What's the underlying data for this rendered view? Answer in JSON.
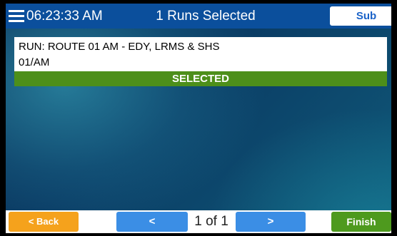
{
  "header": {
    "menu_icon": "hamburger-menu-icon",
    "time": "06:23:33 AM",
    "title": "1 Runs Selected",
    "sub_label": "Sub"
  },
  "run": {
    "line1": "RUN: ROUTE 01 AM - EDY, LRMS & SHS",
    "line2": "01/AM",
    "status": "SELECTED"
  },
  "footer": {
    "back_label": "< Back",
    "prev_label": "<",
    "page_indicator": "1 of 1",
    "next_label": ">",
    "finish_label": "Finish"
  },
  "colors": {
    "header_bg": "#0b4f9c",
    "selected_bar": "#4d8f1a",
    "back_button": "#f5a21c",
    "nav_button": "#3b8ee5",
    "finish_button": "#4e9a1e"
  }
}
